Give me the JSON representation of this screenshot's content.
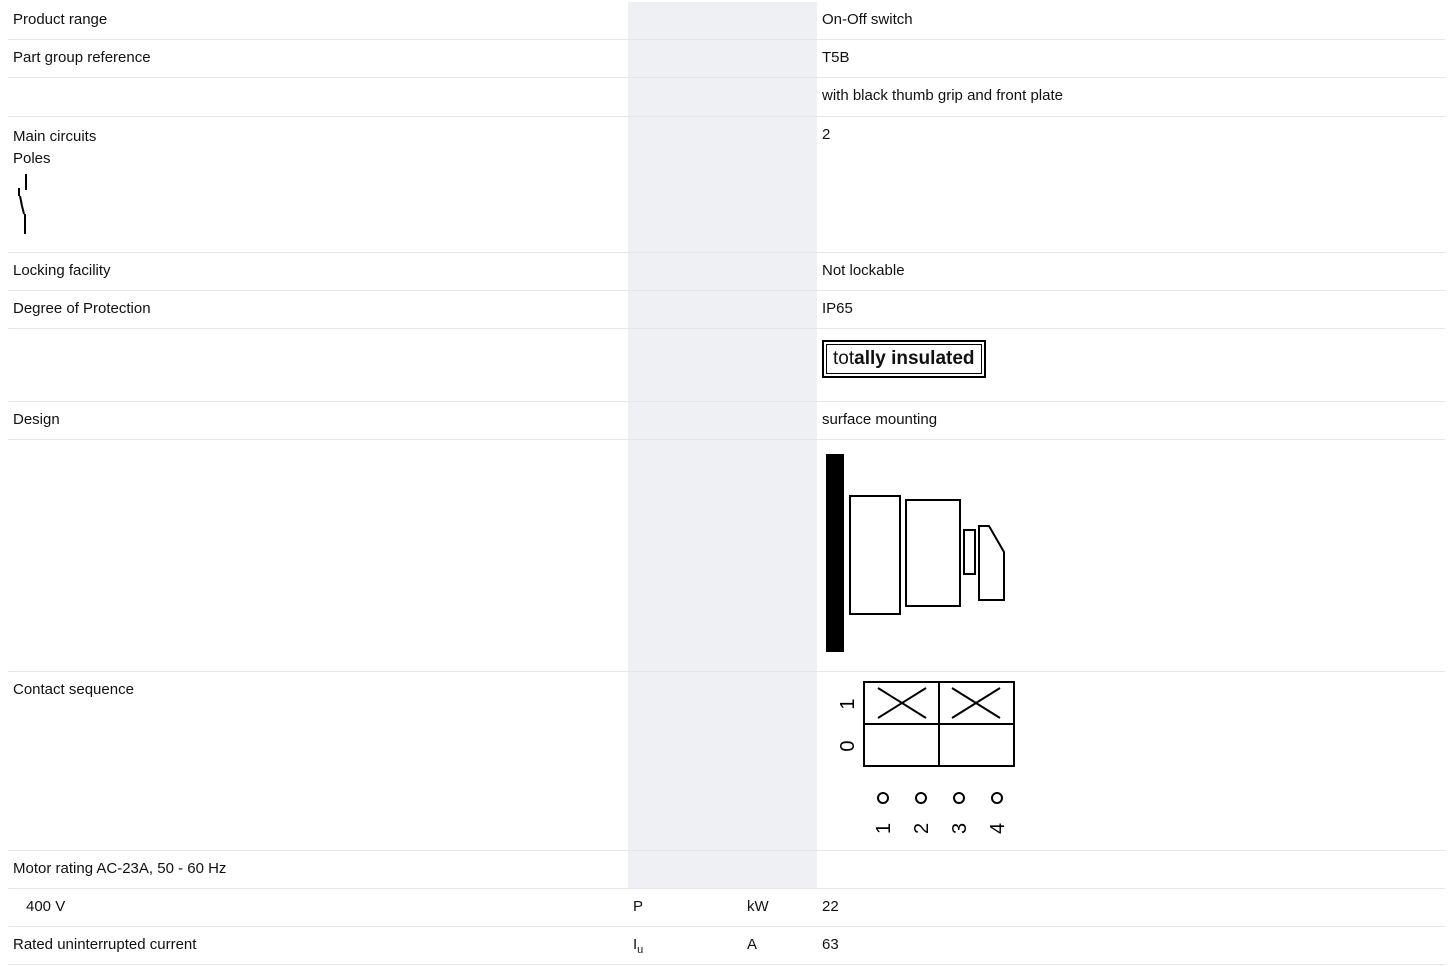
{
  "rows": [
    {
      "label": "Product range",
      "symbol": "",
      "unit": "",
      "value": "On-Off switch"
    },
    {
      "label": "Part group reference",
      "symbol": "",
      "unit": "",
      "value": "T5B"
    },
    {
      "label": "",
      "symbol": "",
      "unit": "",
      "value": "with black thumb grip and front plate"
    },
    {
      "label": "Main circuits",
      "label2": "Poles",
      "symbol": "",
      "unit": "",
      "value": "2"
    },
    {
      "label": "Locking facility",
      "symbol": "",
      "unit": "",
      "value": "Not lockable"
    },
    {
      "label": "Degree of Protection",
      "symbol": "",
      "unit": "",
      "value": "IP65"
    },
    {
      "label": "",
      "symbol": "",
      "unit": "",
      "badge_a": "tot",
      "badge_b": "ally",
      "badge_c": "insulated"
    },
    {
      "label": "Design",
      "symbol": "",
      "unit": "",
      "value": "surface mounting"
    },
    {
      "label": "",
      "symbol": "",
      "unit": "",
      "value": ""
    },
    {
      "label": "Contact sequence",
      "symbol": "",
      "unit": "",
      "value": "",
      "positions": [
        "1",
        "0"
      ],
      "contacts": [
        "1",
        "2",
        "3",
        "4"
      ]
    },
    {
      "label": "Motor rating AC-23A, 50 - 60 Hz",
      "symbol": "",
      "unit": "",
      "value": ""
    },
    {
      "label": "400 V",
      "symbol": "P",
      "unit": "kW",
      "value": "22"
    },
    {
      "label": "Rated uninterrupted current",
      "symbol": "I",
      "symbol_sub": "u",
      "unit": "A",
      "value": "63"
    }
  ]
}
